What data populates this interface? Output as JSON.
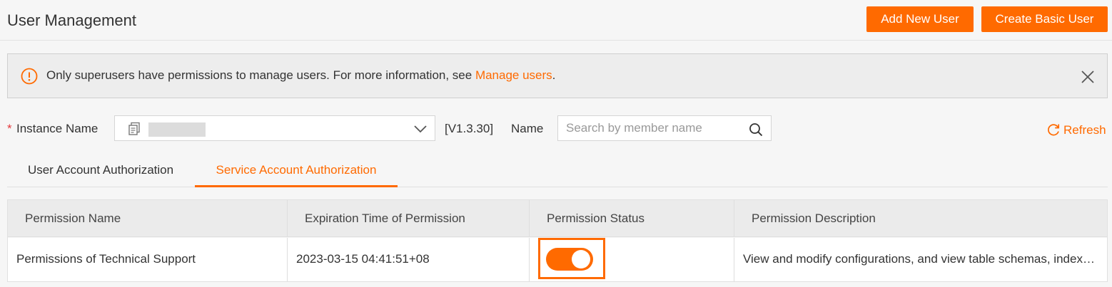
{
  "header": {
    "title": "User Management",
    "add_user_label": "Add New User",
    "create_basic_user_label": "Create Basic User"
  },
  "notice": {
    "text": "Only superusers have permissions to manage users. For more information, see ",
    "link_text": "Manage users",
    "suffix": "."
  },
  "filters": {
    "required_mark": "*",
    "instance_label": "Instance Name",
    "version": "[V1.3.30]",
    "name_label": "Name",
    "search_placeholder": "Search by member name",
    "refresh_label": "Refresh"
  },
  "tabs": [
    {
      "label": "User Account Authorization",
      "active": false
    },
    {
      "label": "Service Account Authorization",
      "active": true
    }
  ],
  "table": {
    "columns": [
      "Permission Name",
      "Expiration Time of Permission",
      "Permission Status",
      "Permission Description"
    ],
    "rows": [
      {
        "name": "Permissions of Technical Support",
        "expiration": "2023-03-15 04:41:51+08",
        "status_enabled": true,
        "description": "View and modify configurations, and view table schemas, indexes..."
      }
    ]
  },
  "colors": {
    "accent": "#ff6a00",
    "required": "#e4393c"
  },
  "icons": {
    "notice": "info-circle-icon",
    "close": "close-icon",
    "instance": "instance-copy-icon",
    "chevron": "chevron-down-icon",
    "search": "search-icon",
    "refresh": "refresh-icon"
  }
}
